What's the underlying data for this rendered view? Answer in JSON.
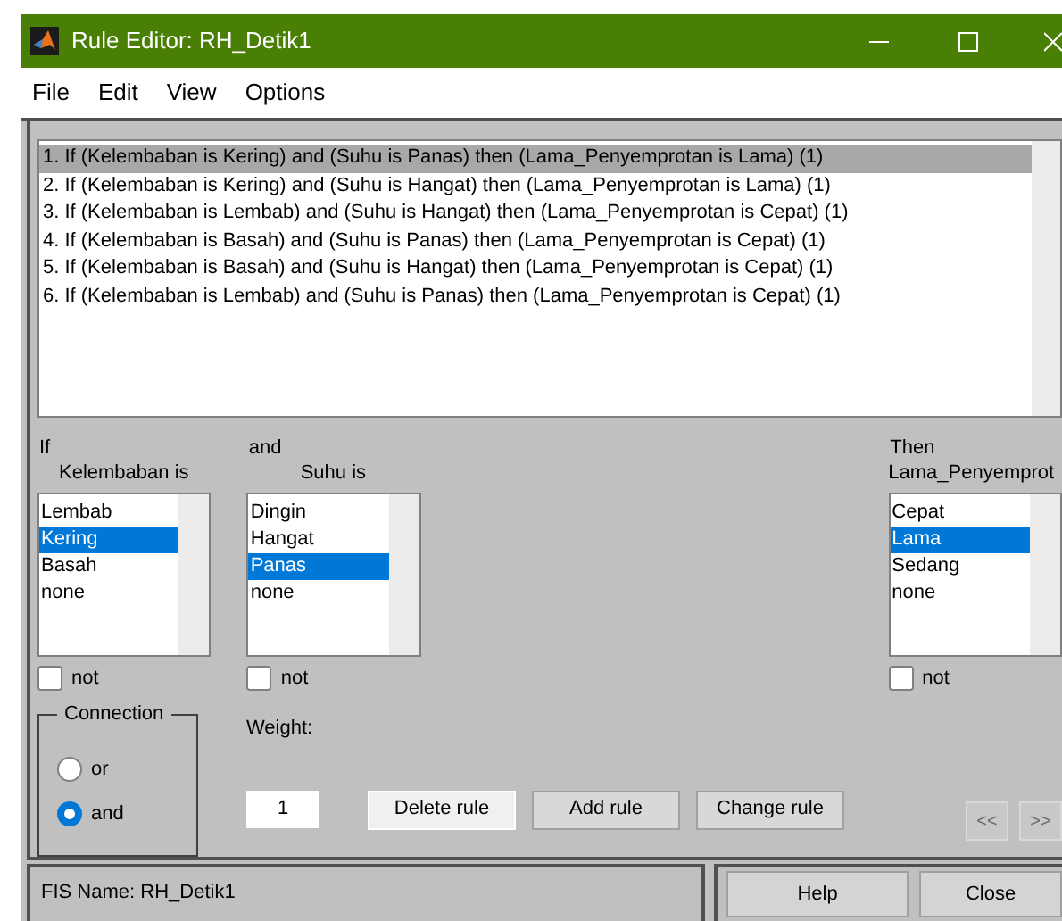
{
  "window": {
    "title": "Rule Editor: RH_Detik1"
  },
  "menu": [
    "File",
    "Edit",
    "View",
    "Options"
  ],
  "rules": [
    {
      "text": "1. If (Kelembaban is Kering) and (Suhu is Panas) then (Lama_Penyemprotan is Lama) (1)",
      "selected": true
    },
    {
      "text": "2. If (Kelembaban is Kering) and (Suhu is Hangat) then (Lama_Penyemprotan is Lama) (1)",
      "selected": false
    },
    {
      "text": "3. If (Kelembaban is Lembab) and (Suhu is Hangat) then (Lama_Penyemprotan is Cepat) (1)",
      "selected": false
    },
    {
      "text": "4. If (Kelembaban is Basah) and (Suhu is Panas) then (Lama_Penyemprotan is Cepat) (1)",
      "selected": false
    },
    {
      "text": "5. If (Kelembaban is Basah) and (Suhu is Hangat) then (Lama_Penyemprotan is Cepat) (1)",
      "selected": false
    },
    {
      "text": "6. If (Kelembaban is Lembab) and (Suhu is Panas) then (Lama_Penyemprotan is Cepat) (1)",
      "selected": false
    }
  ],
  "columns": [
    {
      "label": "If",
      "variable": "Kelembaban is",
      "options": [
        {
          "label": "Lembab",
          "selected": false
        },
        {
          "label": "Kering",
          "selected": true
        },
        {
          "label": "Basah",
          "selected": false
        },
        {
          "label": "none",
          "selected": false
        }
      ],
      "not_label": "not",
      "not_checked": false
    },
    {
      "label": "and",
      "variable": "Suhu is",
      "options": [
        {
          "label": "Dingin",
          "selected": false
        },
        {
          "label": "Hangat",
          "selected": false
        },
        {
          "label": "Panas",
          "selected": true
        },
        {
          "label": "none",
          "selected": false
        }
      ],
      "not_label": "not",
      "not_checked": false
    },
    {
      "label": "Then",
      "variable": "Lama_Penyemprot",
      "options": [
        {
          "label": "Cepat",
          "selected": false
        },
        {
          "label": "Lama",
          "selected": true
        },
        {
          "label": "Sedang",
          "selected": false
        },
        {
          "label": "none",
          "selected": false
        }
      ],
      "not_label": "not",
      "not_checked": false
    }
  ],
  "connection": {
    "title": "Connection",
    "options": [
      {
        "label": "or",
        "selected": false
      },
      {
        "label": "and",
        "selected": true
      }
    ]
  },
  "weight": {
    "label": "Weight:",
    "value": "1"
  },
  "rule_buttons": [
    {
      "label": "Delete rule",
      "focused": true
    },
    {
      "label": "Add rule",
      "focused": false
    },
    {
      "label": "Change rule",
      "focused": false
    }
  ],
  "nav_buttons": [
    {
      "label": "<<",
      "disabled": true
    },
    {
      "label": ">>",
      "disabled": true
    }
  ],
  "status": "FIS Name: RH_Detik1",
  "footer_buttons": [
    "Help",
    "Close"
  ]
}
